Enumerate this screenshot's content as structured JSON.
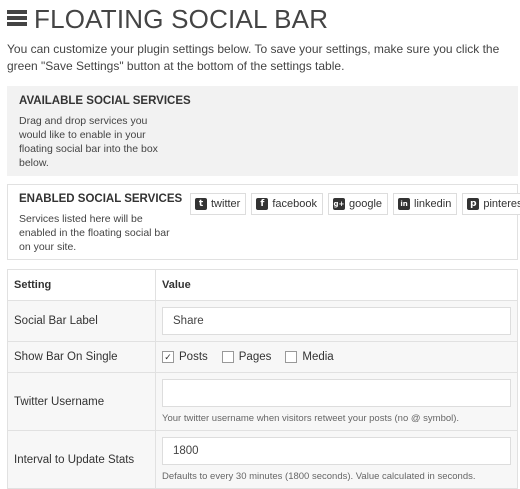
{
  "header": {
    "title": "FLOATING SOCIAL BAR",
    "icon": "stack-icon"
  },
  "intro": "You can customize your plugin settings below. To save your settings, make sure you click the green \"Save Settings\" button at the bottom of the settings table.",
  "available": {
    "title": "AVAILABLE SOCIAL SERVICES",
    "description": "Drag and drop services you would like to enable in your floating social bar into the box below."
  },
  "enabled": {
    "title": "ENABLED SOCIAL SERVICES",
    "description": "Services listed here will be enabled in the floating social bar on your site.",
    "services": [
      {
        "label": "twitter",
        "icon": "twitter-icon",
        "glyph": "t"
      },
      {
        "label": "facebook",
        "icon": "facebook-icon",
        "glyph": "f"
      },
      {
        "label": "google",
        "icon": "google-plus-icon",
        "glyph": "g+"
      },
      {
        "label": "linkedin",
        "icon": "linkedin-icon",
        "glyph": "in"
      },
      {
        "label": "pinterest",
        "icon": "pinterest-icon",
        "glyph": "p"
      }
    ]
  },
  "settings": {
    "header_setting": "Setting",
    "header_value": "Value",
    "rows": {
      "label": {
        "name": "Social Bar Label",
        "value": "Share"
      },
      "show_single": {
        "name": "Show Bar On Single",
        "options": [
          {
            "label": "Posts",
            "checked": true
          },
          {
            "label": "Pages",
            "checked": false
          },
          {
            "label": "Media",
            "checked": false
          }
        ]
      },
      "twitter": {
        "name": "Twitter Username",
        "value": "",
        "hint": "Your twitter username when visitors retweet your posts (no @ symbol)."
      },
      "interval": {
        "name": "Interval to Update Stats",
        "value": "1800",
        "hint": "Defaults to every 30 minutes (1800 seconds). Value calculated in seconds."
      }
    }
  },
  "colors": {
    "panel_bg": "#f2f2f2",
    "border": "#e1e1e1",
    "text": "#333333"
  }
}
